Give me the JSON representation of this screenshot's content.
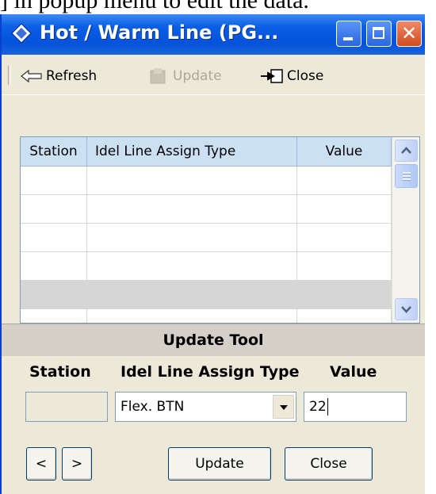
{
  "doc_text": "] in popup menu to edit the data.",
  "window": {
    "title": "Hot / Warm Line (PG...",
    "minimize_icon": "minimize-icon",
    "maximize_icon": "maximize-icon",
    "close_icon": "close-icon",
    "close_glyph": "✕"
  },
  "toolbar": {
    "refresh_label": "Refresh",
    "update_label": "Update",
    "close_label": "Close",
    "update_enabled": false
  },
  "grid": {
    "columns": [
      "Station",
      "Idel Line Assign Type",
      "Value"
    ],
    "rows": [
      [
        "",
        "",
        ""
      ],
      [
        "",
        "",
        ""
      ],
      [
        "",
        "",
        ""
      ],
      [
        "",
        "",
        ""
      ],
      [
        "",
        "",
        ""
      ],
      [
        "",
        "",
        ""
      ]
    ],
    "selected_row": 4
  },
  "update_tool": {
    "title": "Update Tool",
    "station_label": "Station",
    "type_label": "Idel Line Assign Type",
    "value_label": "Value",
    "station_value": "",
    "type_value": "Flex. BTN",
    "value_value": "22",
    "prev_label": "<",
    "next_label": ">",
    "update_label": "Update",
    "close_label": "Close"
  },
  "colors": {
    "titlebar": "#0553dc",
    "grid_header": "#cce0f4",
    "panel": "#ece9d8",
    "selected_row": "#d6d6d6"
  }
}
